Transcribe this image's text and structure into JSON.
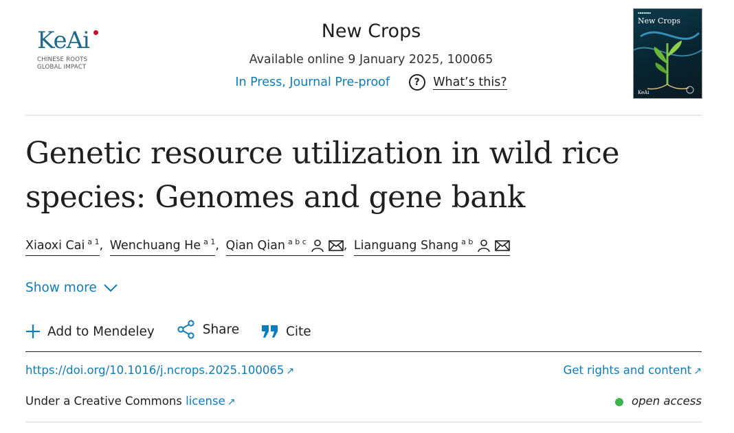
{
  "logo": {
    "word": "KeAi",
    "tagline_1": "CHINESE ROOTS",
    "tagline_2": "GLOBAL IMPACT"
  },
  "journal": {
    "title": "New Crops",
    "available": "Available online 9 January 2025, 100065",
    "status": "In Press, Journal Pre-proof",
    "whats_this": "What’s this?"
  },
  "cover": {
    "title": "New Crops",
    "logo": "KeAi"
  },
  "article": {
    "title": "Genetic resource utilization in wild rice species: Genomes and gene bank",
    "authors": [
      {
        "name": "Xiaoxi Cai",
        "sup": "a 1"
      },
      {
        "name": "Wenchuang He",
        "sup": "a 1"
      },
      {
        "name": "Qian Qian",
        "sup": "a b c"
      },
      {
        "name": "Lianguang Shang",
        "sup": "a b"
      }
    ]
  },
  "show_more": "Show more",
  "actions": {
    "mendeley": "Add to Mendeley",
    "share": "Share",
    "cite": "Cite"
  },
  "doi": "https://doi.org/10.1016/j.ncrops.2025.100065",
  "rights": "Get rights and content",
  "license": {
    "prefix": "Under a Creative Commons",
    "link": "license"
  },
  "open_access": "open access",
  "colors": {
    "link": "#0c7dbb",
    "open_access_dot": "#3cb44b",
    "brand": "#1f6a8a"
  }
}
